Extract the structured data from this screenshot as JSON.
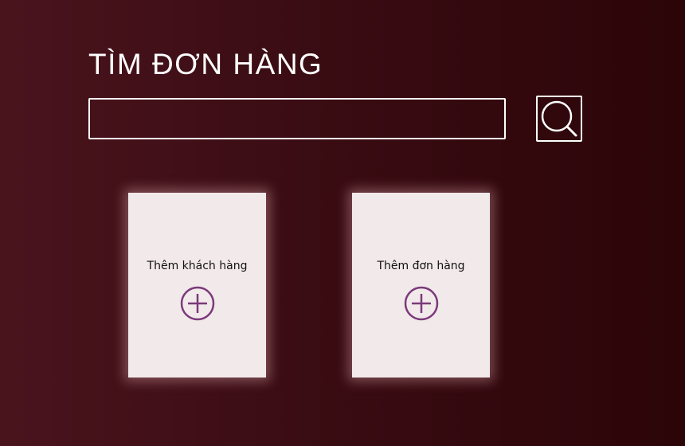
{
  "search": {
    "title": "TÌM ĐƠN HÀNG",
    "input_value": "",
    "button_icon": "search-icon"
  },
  "cards": {
    "add_customer": {
      "label": "Thêm khách hàng",
      "icon": "plus-circle-icon"
    },
    "add_order": {
      "label": "Thêm đơn hàng",
      "icon": "plus-circle-icon"
    }
  },
  "colors": {
    "background_left": "#4a141d",
    "background_right": "#2c0508",
    "card_background": "#f2e9ea",
    "icon_accent": "#7b3a7a",
    "text_light": "#ffffff"
  }
}
